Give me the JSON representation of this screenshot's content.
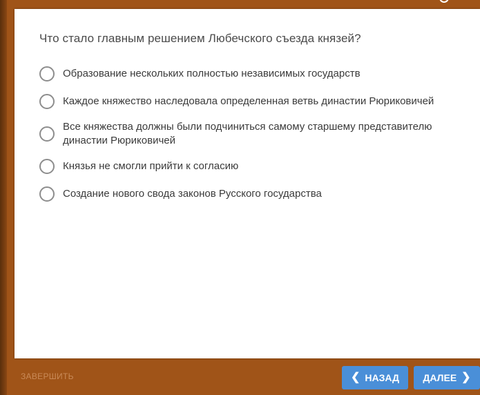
{
  "quiz": {
    "question": "Что стало главным решением Любечского съезда князей?",
    "options": [
      {
        "label": "Образование нескольких полностью независимых государств"
      },
      {
        "label": "Каждое княжество наследовала определенная ветвь династии Рюриковичей"
      },
      {
        "label": "Все княжества должны были подчиниться самому старшему представителю династии Рюриковичей"
      },
      {
        "label": "Князья не смогли прийти к согласию"
      },
      {
        "label": "Создание нового свода законов Русского государства"
      }
    ]
  },
  "footer": {
    "finish_label": "ЗАВЕРШИТЬ",
    "back_label": "НАЗАД",
    "next_label": "ДАЛЕЕ"
  },
  "icons": {
    "back": "chevron-left-icon",
    "next": "chevron-right-icon"
  },
  "colors": {
    "background": "#a05418",
    "card": "#ffffff",
    "button": "#4a8fd8",
    "finish_text": "#c98a58",
    "radio_border": "#8d8d8d"
  }
}
